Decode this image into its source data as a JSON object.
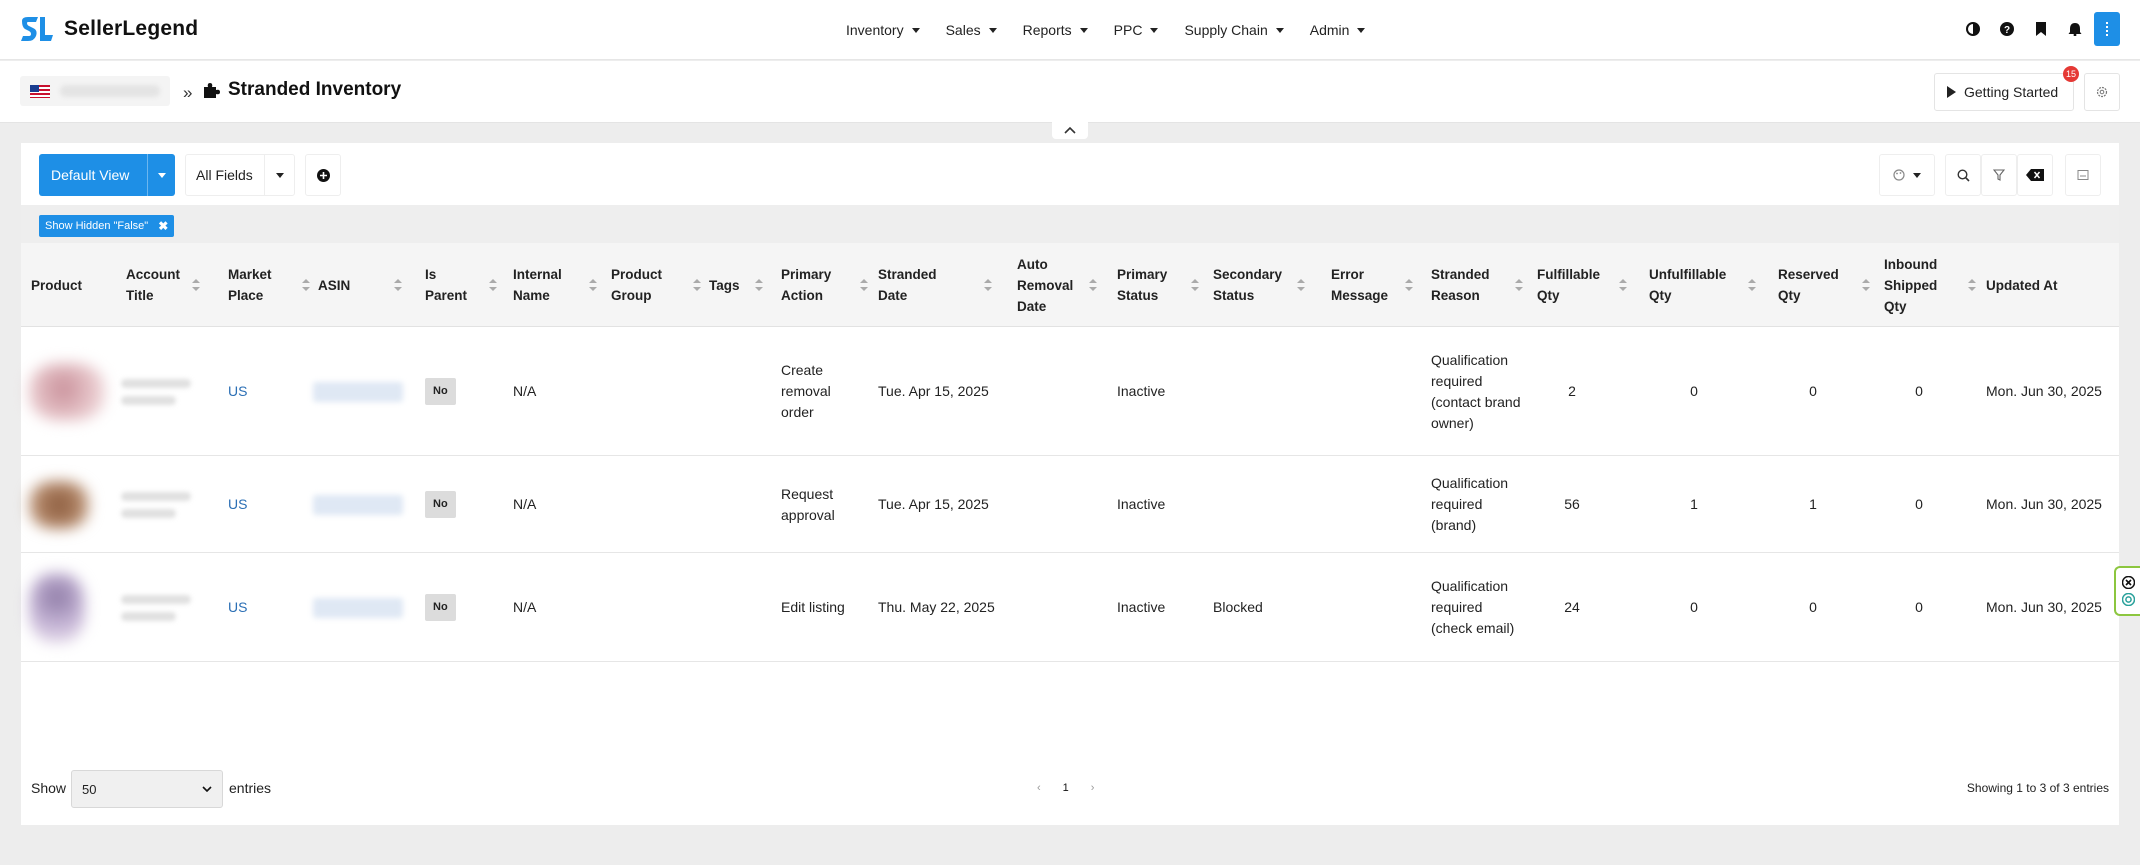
{
  "app": {
    "brand": "SellerLegend"
  },
  "nav": [
    {
      "label": "Inventory"
    },
    {
      "label": "Sales"
    },
    {
      "label": "Reports"
    },
    {
      "label": "PPC"
    },
    {
      "label": "Supply Chain"
    },
    {
      "label": "Admin"
    }
  ],
  "header": {
    "breadcrumb_sep": "»",
    "title": "Stranded Inventory",
    "getting_started": "Getting Started",
    "notification_count": "15"
  },
  "toolbar": {
    "view_label": "Default View",
    "fields_label": "All Fields"
  },
  "filters": {
    "chip": "Show Hidden \"False\""
  },
  "table": {
    "columns": [
      {
        "label": "Product"
      },
      {
        "label": "Account Title"
      },
      {
        "label": "Market Place"
      },
      {
        "label": "ASIN"
      },
      {
        "label": "Is Parent"
      },
      {
        "label": "Internal Name"
      },
      {
        "label": "Product Group"
      },
      {
        "label": "Tags"
      },
      {
        "label": "Primary Action"
      },
      {
        "label": "Stranded Date"
      },
      {
        "label": "Auto Removal Date"
      },
      {
        "label": "Primary Status"
      },
      {
        "label": "Secondary Status"
      },
      {
        "label": "Error Message"
      },
      {
        "label": "Stranded Reason"
      },
      {
        "label": "Fulfillable Qty"
      },
      {
        "label": "Unfulfillable Qty"
      },
      {
        "label": "Reserved Qty"
      },
      {
        "label": "Inbound Shipped Qty"
      },
      {
        "label": "Updated At"
      }
    ],
    "rows": [
      {
        "marketplace": "US",
        "is_parent": "No",
        "internal_name": "N/A",
        "primary_action": "Create removal order",
        "stranded_date": "Tue. Apr 15, 2025",
        "primary_status": "Inactive",
        "secondary_status": "",
        "stranded_reason": "Qualification required (contact brand owner)",
        "fulfillable": "2",
        "unfulfillable": "0",
        "reserved": "0",
        "inbound": "0",
        "updated_at": "Mon. Jun 30, 2025",
        "thumb_color": "#c9909a"
      },
      {
        "marketplace": "US",
        "is_parent": "No",
        "internal_name": "N/A",
        "primary_action": "Request approval",
        "stranded_date": "Tue. Apr 15, 2025",
        "primary_status": "Inactive",
        "secondary_status": "",
        "stranded_reason": "Qualification required (brand)",
        "fulfillable": "56",
        "unfulfillable": "1",
        "reserved": "1",
        "inbound": "0",
        "updated_at": "Mon. Jun 30, 2025",
        "thumb_color": "#8a5a3c"
      },
      {
        "marketplace": "US",
        "is_parent": "No",
        "internal_name": "N/A",
        "primary_action": "Edit listing",
        "stranded_date": "Thu. May 22, 2025",
        "primary_status": "Inactive",
        "secondary_status": "Blocked",
        "stranded_reason": "Qualification required (check email)",
        "fulfillable": "24",
        "unfulfillable": "0",
        "reserved": "0",
        "inbound": "0",
        "updated_at": "Mon. Jun 30, 2025",
        "thumb_color": "#8e7ba6"
      }
    ]
  },
  "footer": {
    "show_label": "Show",
    "page_length": "50",
    "entries_label": "entries",
    "prev": "‹",
    "current_page": "1",
    "next": "›",
    "info": "Showing 1 to 3 of 3 entries"
  },
  "colors": {
    "accent": "#1e8fe6",
    "link": "#2b6fb5",
    "badge": "#e53935"
  }
}
